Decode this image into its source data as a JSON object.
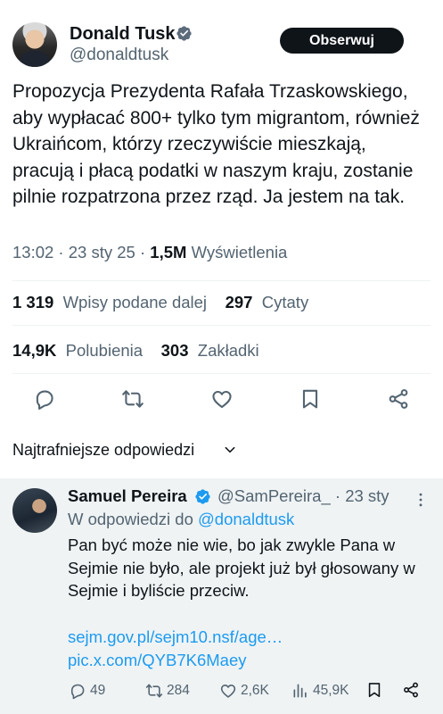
{
  "tweet": {
    "author_name": "Donald Tusk",
    "author_handle": "@donaldtusk",
    "follow_label": "Obserwuj",
    "text": "Propozycja Prezydenta Rafała Trzaskowskiego, aby wypłacać 800+ tylko tym migrantom, również Ukraińcom, którzy rzeczywiście mieszkają, pracują i płacą podatki w naszym kraju, zostanie pilnie rozpatrzona przez rząd. Ja jestem na tak.",
    "time": "13:02",
    "date": "23 sty 25",
    "views_count": "1,5M",
    "views_label": "Wyświetlenia",
    "reposts_count": "1 319",
    "reposts_label": "Wpisy podane dalej",
    "quotes_count": "297",
    "quotes_label": "Cytaty",
    "likes_count": "14,9K",
    "likes_label": "Polubienia",
    "bookmarks_count": "303",
    "bookmarks_label": "Zakładki"
  },
  "sort_label": "Najtrafniejsze odpowiedzi",
  "reply": {
    "author_name": "Samuel Pereira",
    "author_handle": "@SamPereira_",
    "date": "23 sty",
    "replying_prefix": "W odpowiedzi do",
    "replying_to": "@donaldtusk",
    "text": "Pan być może nie wie, bo jak zwykle Pana w Sejmie nie było, ale projekt już był głosowany w Sejmie i byliście przeciw.",
    "links": "sejm.gov.pl/sejm10.nsf/age… pic.x.com/QYB7K6Maey",
    "replies": "49",
    "reposts": "284",
    "likes": "2,6K",
    "views": "45,9K"
  },
  "colors": {
    "accent": "#1d9bf0",
    "secondary_text": "#536471",
    "reply_bg": "#eff3f4"
  }
}
